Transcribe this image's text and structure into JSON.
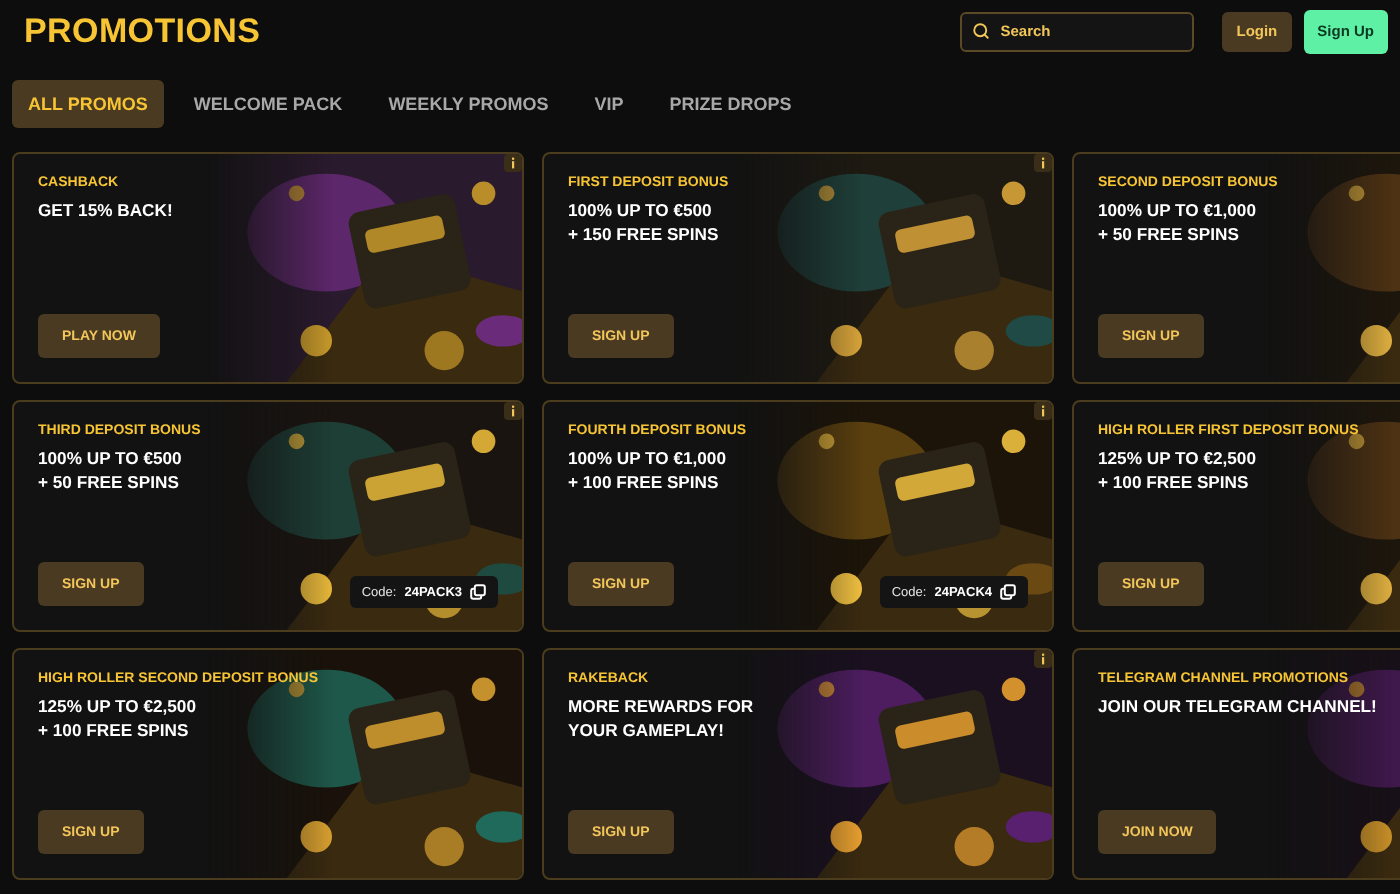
{
  "header": {
    "title": "PROMOTIONS",
    "search": {
      "placeholder": "Search"
    },
    "buttons": [
      {
        "label": "Login",
        "kind": "secondary"
      },
      {
        "label": "Sign Up",
        "kind": "primary"
      }
    ]
  },
  "tabs": [
    {
      "label": "ALL PROMOS",
      "selected": true
    },
    {
      "label": "WELCOME PACK",
      "selected": false
    },
    {
      "label": "WEEKLY PROMOS",
      "selected": false
    },
    {
      "label": "VIP",
      "selected": false
    },
    {
      "label": "PRIZE DROPS",
      "selected": false
    }
  ],
  "promotions": [
    {
      "category": "CASHBACK",
      "headline": [
        "GET 15% BACK!"
      ],
      "button": "PLAY NOW",
      "info": true
    },
    {
      "category": "FIRST DEPOSIT BONUS",
      "headline": [
        "100% UP TO €500",
        "+ 150 FREE SPINS"
      ],
      "button": "SIGN UP",
      "info": true
    },
    {
      "category": "SECOND DEPOSIT BONUS",
      "headline": [
        "100% UP TO €1,000",
        "+ 50 FREE SPINS"
      ],
      "button": "SIGN UP",
      "info": false
    },
    {
      "category": "THIRD DEPOSIT BONUS",
      "headline": [
        "100% UP TO €500",
        "+ 50 FREE SPINS"
      ],
      "button": "SIGN UP",
      "info": true,
      "code_label": "Code:",
      "code": "24PACK3"
    },
    {
      "category": "FOURTH DEPOSIT BONUS",
      "headline": [
        "100% UP TO €1,000",
        "+ 100 FREE SPINS"
      ],
      "button": "SIGN UP",
      "info": true,
      "code_label": "Code:",
      "code": "24PACK4"
    },
    {
      "category": "HIGH ROLLER FIRST DEPOSIT BONUS",
      "headline": [
        "125% UP TO €2,500",
        "+ 100 FREE SPINS"
      ],
      "button": "SIGN UP",
      "info": false
    },
    {
      "category": "HIGH ROLLER SECOND DEPOSIT BONUS",
      "headline": [
        "125% UP TO €2,500",
        "+ 100 FREE SPINS"
      ],
      "button": "SIGN UP",
      "info": false
    },
    {
      "category": "RAKEBACK",
      "headline": [
        "MORE REWARDS FOR",
        "YOUR GAMEPLAY!"
      ],
      "button": "SIGN UP",
      "info": true
    },
    {
      "category": "TELEGRAM CHANNEL PROMOTIONS",
      "headline": [
        "JOIN OUR TELEGRAM CHANNEL!"
      ],
      "button": "JOIN NOW",
      "info": false
    }
  ]
}
